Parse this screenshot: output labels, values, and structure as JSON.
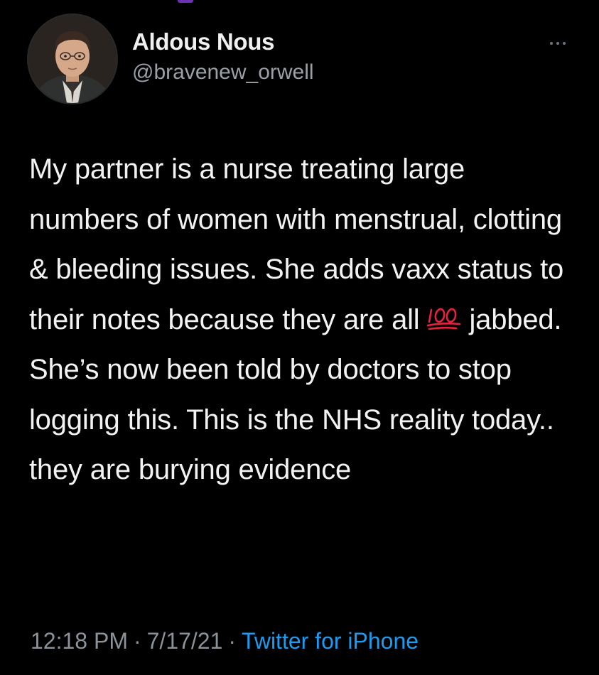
{
  "tweet": {
    "author": {
      "display_name": "Aldous Nous",
      "handle": "@bravenew_orwell"
    },
    "text_before_emoji": "My partner is a nurse treating  large numbers of women with menstrual, clotting & bleeding issues. She adds vaxx status to their notes because they are all",
    "emoji": "hundred-points-emoji",
    "text_after_emoji": "jabbed. She’s now been told by doctors to stop logging this. This is the NHS reality today.. they are burying evidence",
    "time": "12:18 PM",
    "date": "7/17/21",
    "separator": "·",
    "source": "Twitter for iPhone"
  },
  "icons": {
    "more": "more-horizontal-icon",
    "avatar": "profile-photo"
  },
  "colors": {
    "background": "#000000",
    "text": "#f2f2f2",
    "secondary": "#8b9299",
    "link": "#1d9bf0",
    "emoji_red": "#e5233d"
  }
}
